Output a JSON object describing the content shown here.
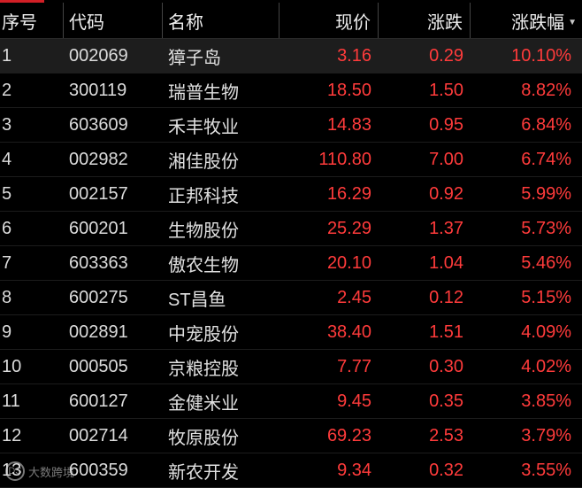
{
  "header": {
    "col_index": "序号",
    "col_code": "代码",
    "col_name": "名称",
    "col_price": "现价",
    "col_change": "涨跌",
    "col_pct": "涨跌幅",
    "sort_icon": "sort-desc-icon"
  },
  "colors": {
    "up": "#ff3b3b",
    "accent": "#d21f26",
    "background": "#000000"
  },
  "rows": [
    {
      "idx": "1",
      "code": "002069",
      "name": "獐子岛",
      "price": "3.16",
      "change": "0.29",
      "pct": "10.10%"
    },
    {
      "idx": "2",
      "code": "300119",
      "name": "瑞普生物",
      "price": "18.50",
      "change": "1.50",
      "pct": "8.82%"
    },
    {
      "idx": "3",
      "code": "603609",
      "name": "禾丰牧业",
      "price": "14.83",
      "change": "0.95",
      "pct": "6.84%"
    },
    {
      "idx": "4",
      "code": "002982",
      "name": "湘佳股份",
      "price": "110.80",
      "change": "7.00",
      "pct": "6.74%"
    },
    {
      "idx": "5",
      "code": "002157",
      "name": "正邦科技",
      "price": "16.29",
      "change": "0.92",
      "pct": "5.99%"
    },
    {
      "idx": "6",
      "code": "600201",
      "name": "生物股份",
      "price": "25.29",
      "change": "1.37",
      "pct": "5.73%"
    },
    {
      "idx": "7",
      "code": "603363",
      "name": "傲农生物",
      "price": "20.10",
      "change": "1.04",
      "pct": "5.46%"
    },
    {
      "idx": "8",
      "code": "600275",
      "name": "ST昌鱼",
      "price": "2.45",
      "change": "0.12",
      "pct": "5.15%"
    },
    {
      "idx": "9",
      "code": "002891",
      "name": "中宠股份",
      "price": "38.40",
      "change": "1.51",
      "pct": "4.09%"
    },
    {
      "idx": "10",
      "code": "000505",
      "name": "京粮控股",
      "price": "7.77",
      "change": "0.30",
      "pct": "4.02%"
    },
    {
      "idx": "11",
      "code": "600127",
      "name": "金健米业",
      "price": "9.45",
      "change": "0.35",
      "pct": "3.85%"
    },
    {
      "idx": "12",
      "code": "002714",
      "name": "牧原股份",
      "price": "69.23",
      "change": "2.53",
      "pct": "3.79%"
    },
    {
      "idx": "13",
      "code": "600359",
      "name": "新农开发",
      "price": "9.34",
      "change": "0.32",
      "pct": "3.55%"
    }
  ],
  "selected_row": 0,
  "watermark": {
    "text": "大数跨境",
    "logo": "DS"
  }
}
